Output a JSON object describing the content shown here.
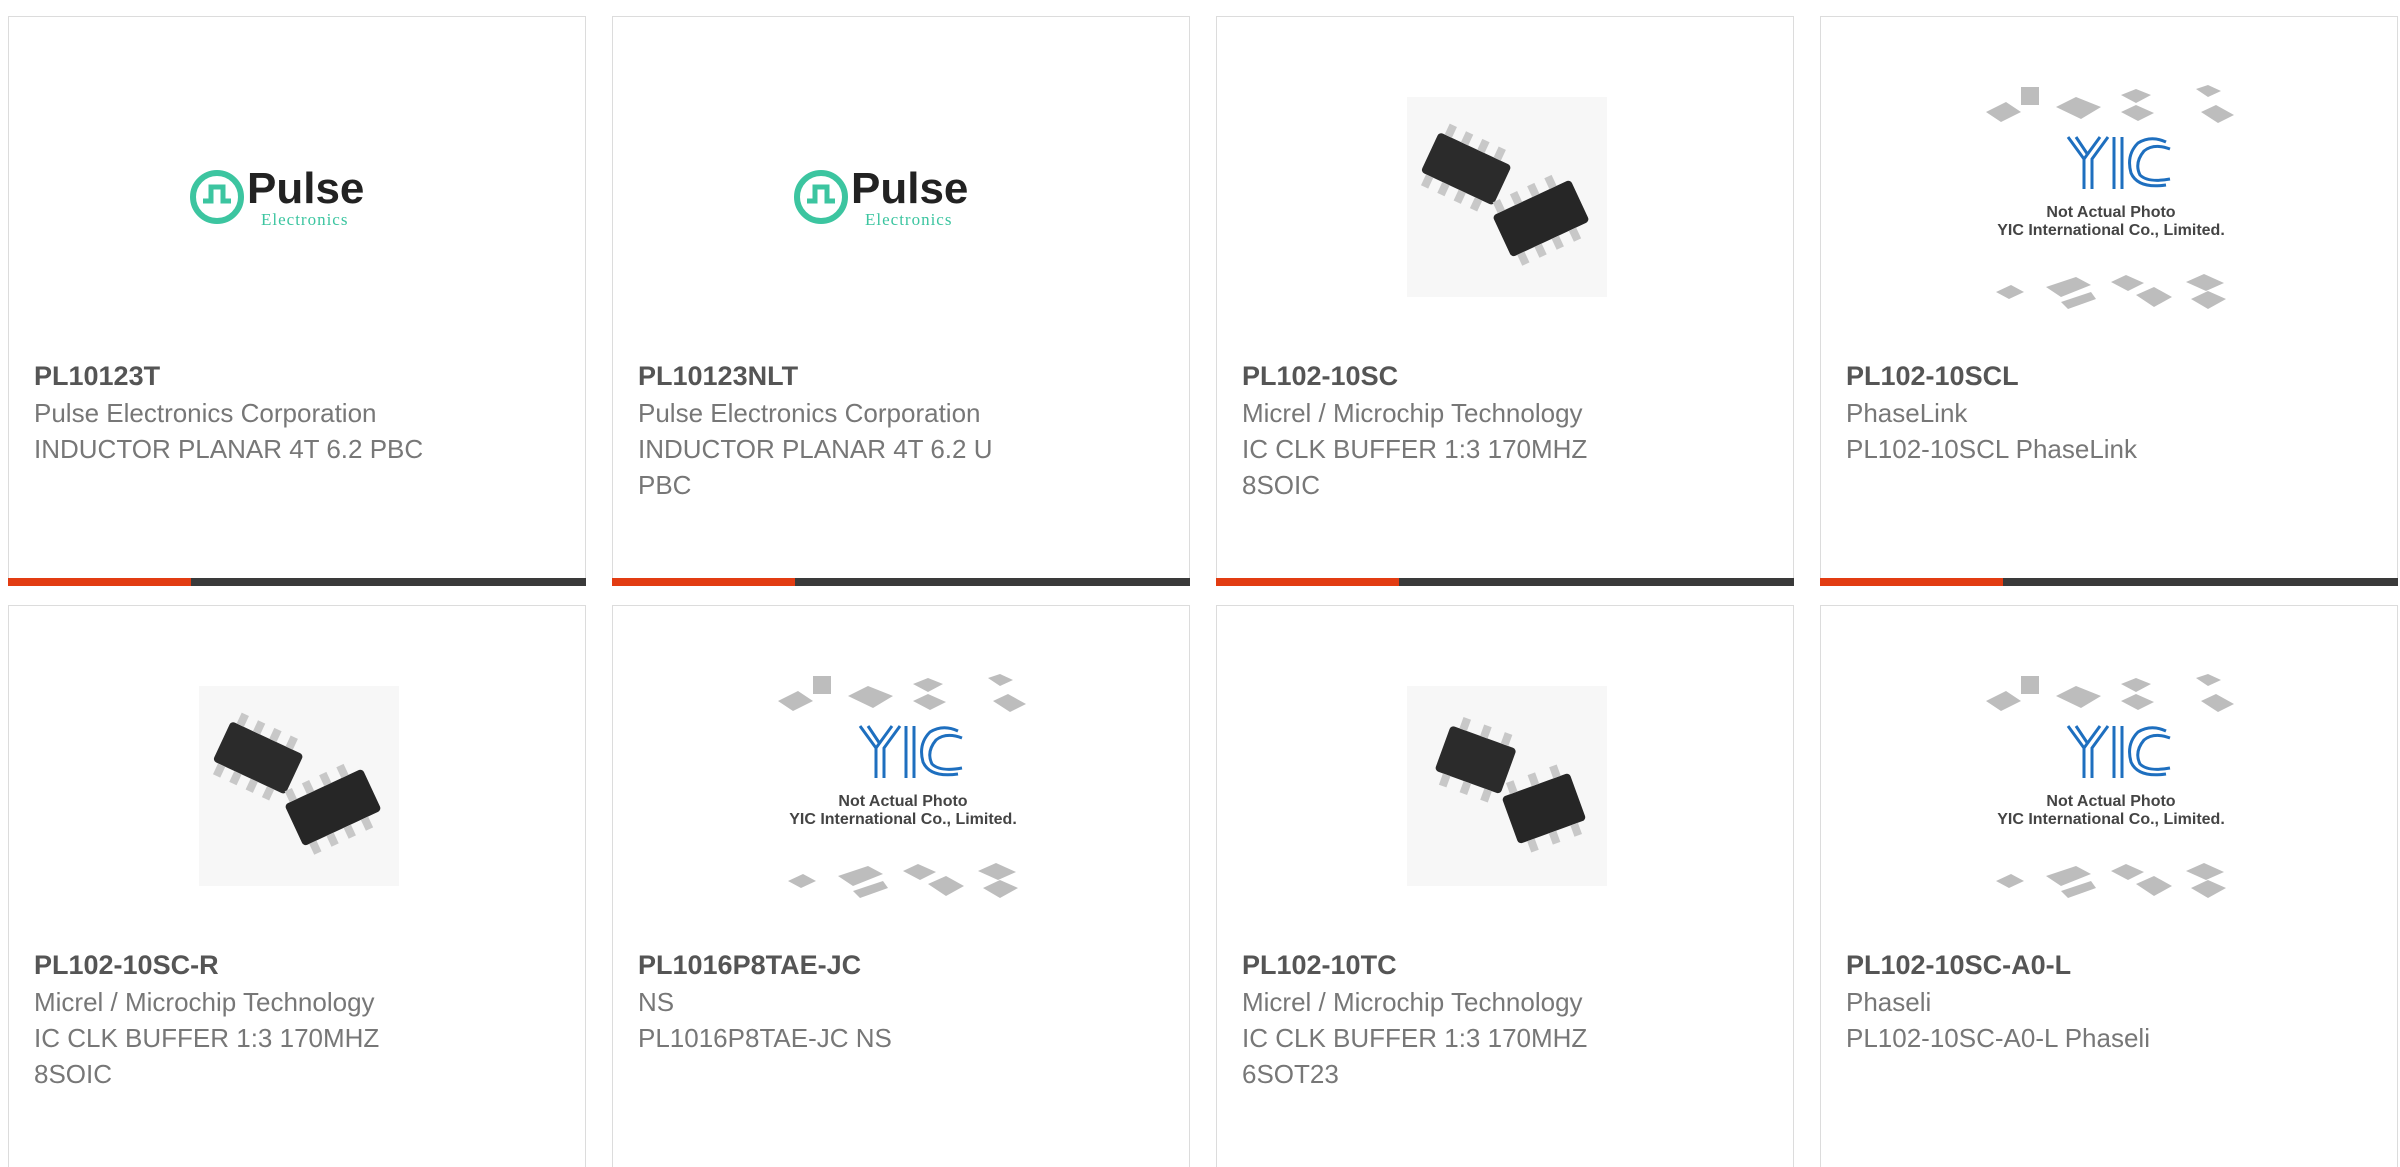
{
  "products": [
    {
      "part": "PL10123T",
      "manufacturer": "Pulse Electronics Corporation",
      "description": "INDUCTOR PLANAR 4T 6.2 PBC",
      "image": "pulse-logo"
    },
    {
      "part": "PL10123NLT",
      "manufacturer": "Pulse Electronics Corporation",
      "description": "INDUCTOR PLANAR 4T 6.2 U PBC",
      "image": "pulse-logo"
    },
    {
      "part": "PL102-10SC",
      "manufacturer": "Micrel / Microchip Technology",
      "description": "IC CLK BUFFER 1:3 170MHZ 8SOIC",
      "image": "soic8-chip"
    },
    {
      "part": "PL102-10SCL",
      "manufacturer": "PhaseLink",
      "description": "PL102-10SCL PhaseLink",
      "image": "yic-placeholder"
    },
    {
      "part": "PL102-10SC-R",
      "manufacturer": "Micrel / Microchip Technology",
      "description": "IC CLK BUFFER 1:3 170MHZ 8SOIC",
      "image": "soic8-chip"
    },
    {
      "part": "PL1016P8TAE-JC",
      "manufacturer": "NS",
      "description": "PL1016P8TAE-JC NS",
      "image": "yic-placeholder"
    },
    {
      "part": "PL102-10TC",
      "manufacturer": "Micrel / Microchip Technology",
      "description": "IC CLK BUFFER 1:3 170MHZ 6SOT23",
      "image": "sot23-chip"
    },
    {
      "part": "PL102-10SC-A0-L",
      "manufacturer": "Phaseli",
      "description": "PL102-10SC-A0-L Phaseli",
      "image": "yic-placeholder"
    }
  ],
  "logo": {
    "brand": "Pulse",
    "sub": "Electronics"
  },
  "placeholder": {
    "brand": "YIC",
    "line1": "Not Actual Photo",
    "line2": "YIC International Co., Limited."
  },
  "colors": {
    "accent": "#e23c12",
    "bar": "#3a3a3a",
    "logo_teal": "#3cc5a0",
    "yic_blue": "#1e6fbf"
  }
}
